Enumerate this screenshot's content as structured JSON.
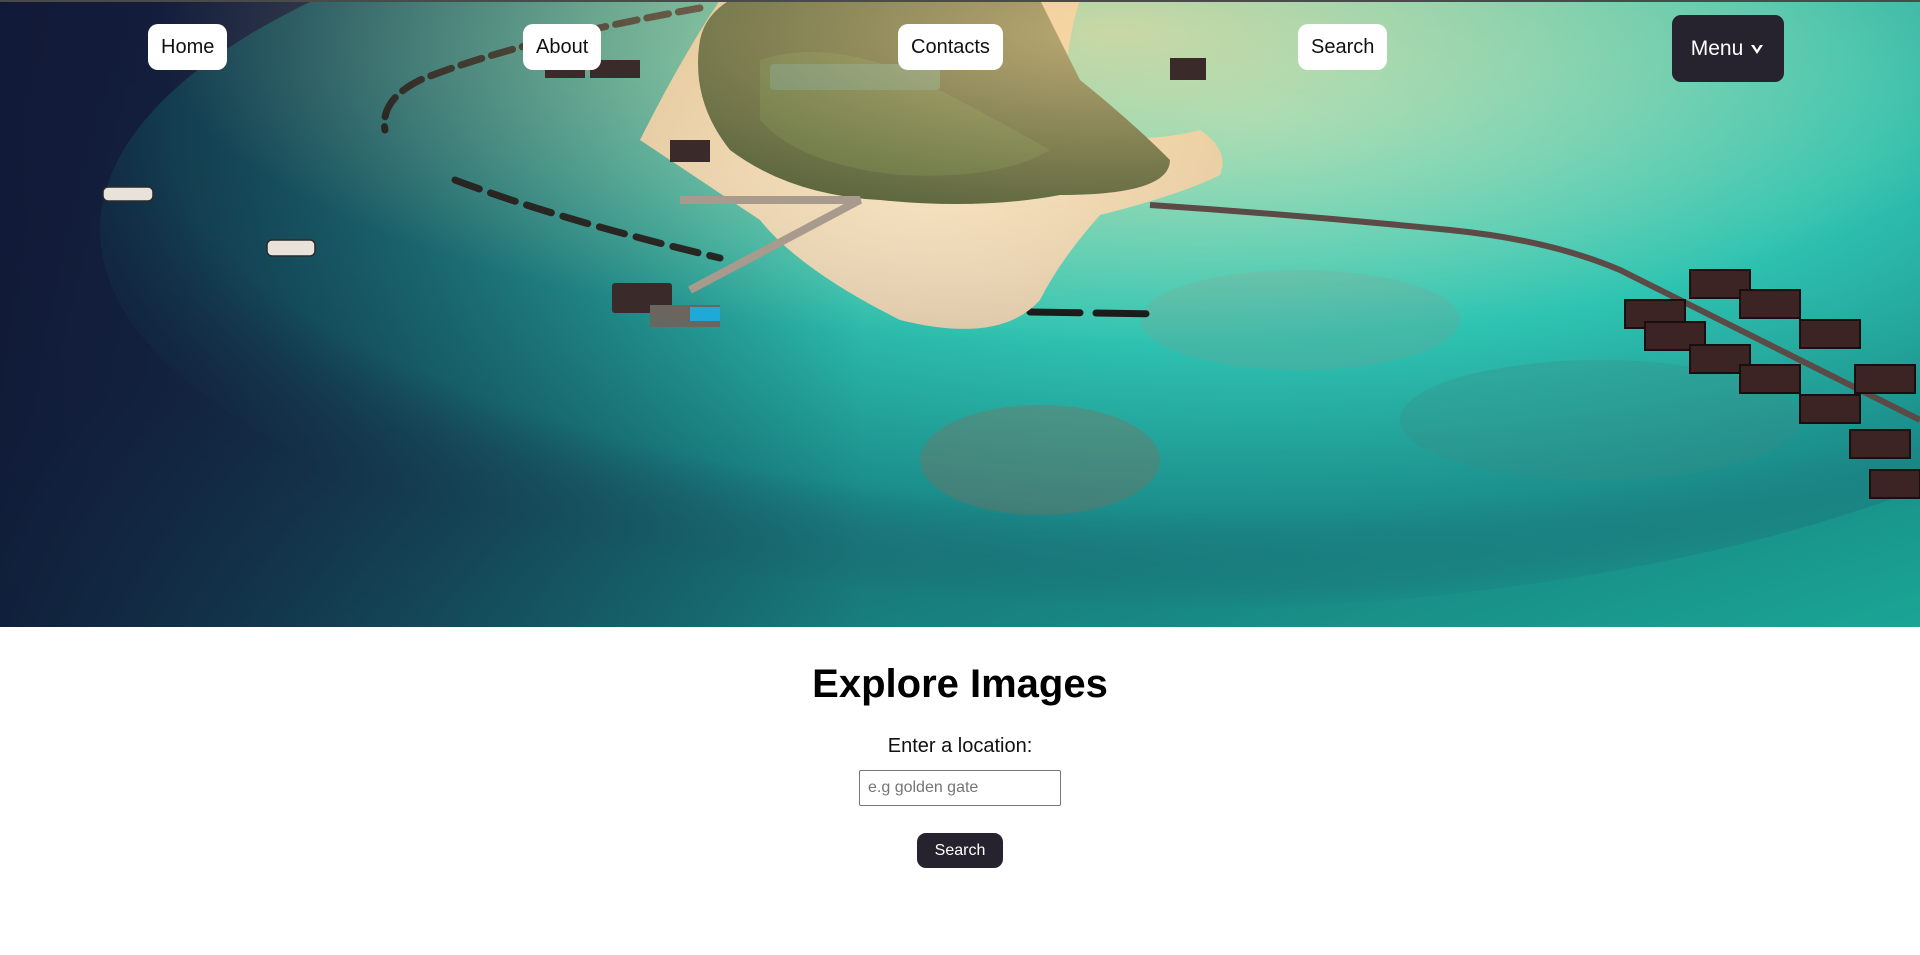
{
  "nav": {
    "items": [
      {
        "label": "Home"
      },
      {
        "label": "About"
      },
      {
        "label": "Contacts"
      },
      {
        "label": "Search"
      }
    ],
    "menu_label": "Menu",
    "menu_icon": "chevron-down-icon"
  },
  "hero": {
    "image": "aerial view of a tropical island resort with overwater bungalows",
    "colors": {
      "deep_water": "#141d3a",
      "lagoon": "#2fc4b2",
      "sand": "#efe0c8"
    }
  },
  "main": {
    "title": "Explore Images",
    "location_label": "Enter a location:",
    "location_placeholder": "e.g golden gate",
    "location_value": "",
    "search_button": "Search"
  },
  "colors": {
    "accent_dark": "#27232e",
    "pill_bg": "#ffffff"
  }
}
